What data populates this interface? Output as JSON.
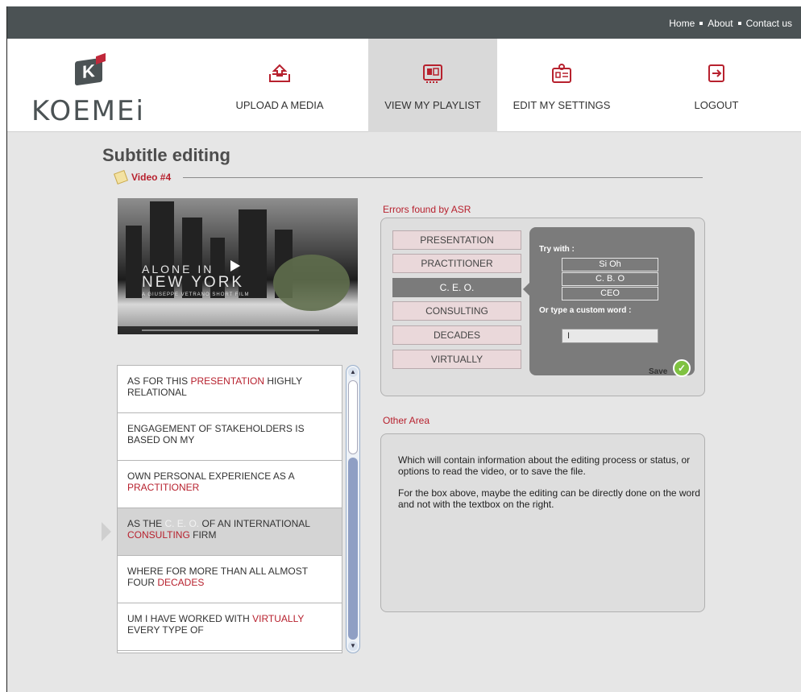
{
  "top_links": [
    "Home",
    "About",
    "Contact us"
  ],
  "logo": {
    "letter": "K",
    "word": "KOEMEi"
  },
  "nav": [
    {
      "label": "UPLOAD A MEDIA",
      "icon": "upload-icon"
    },
    {
      "label": "VIEW MY PLAYLIST",
      "icon": "playlist-icon"
    },
    {
      "label": "EDIT MY SETTINGS",
      "icon": "settings-icon"
    },
    {
      "label": "LOGOUT",
      "icon": "logout-icon"
    }
  ],
  "page": {
    "title": "Subtitle editing",
    "video_label": "Video #4"
  },
  "video": {
    "line1": "ALONE IN",
    "line2": "NEW YORK",
    "line3": "A GIUSEPPE VETRANO SHORT FILM"
  },
  "subtitles": [
    {
      "pre": "AS FOR THIS ",
      "err": "PRESENTATION",
      "post": " HIGHLY RELATIONAL"
    },
    {
      "pre": "ENGAGEMENT OF STAKEHOLDERS IS BASED ON MY",
      "err": "",
      "post": ""
    },
    {
      "pre": "OWN PERSONAL EXPERIENCE AS A ",
      "err": "PRACTITIONER",
      "post": ""
    },
    {
      "pre": "AS THE ",
      "err": "C. E. O.",
      "post": " OF AN INTERNATIONAL ",
      "err2": "CONSULTING",
      "post2": " FIRM",
      "active": true
    },
    {
      "pre": "WHERE FOR MORE THAN ALL ALMOST FOUR ",
      "err": "DECADES",
      "post": ""
    },
    {
      "pre": "UM I HAVE WORKED WITH ",
      "err": "VIRTUALLY",
      "post": " EVERY TYPE OF"
    }
  ],
  "errors_panel": {
    "title": "Errors found by ASR",
    "words": [
      "PRESENTATION",
      "PRACTITIONER",
      "C. E. O.",
      "CONSULTING",
      "DECADES",
      "VIRTUALLY"
    ],
    "active_index": 2,
    "try_with_label": "Try with :",
    "suggestions": [
      "Si Oh",
      "C. B. O",
      "CEO"
    ],
    "custom_label": "Or type a custom word :",
    "custom_value": "I",
    "save_label": "Save"
  },
  "other_area": {
    "title": "Other Area",
    "paragraph1": "Which will contain information about the editing process or status, or options to read the video, or to save the file.",
    "paragraph2": "For the box above, maybe the editing can be directly done on the word and not with the textbox on the right."
  },
  "colors": {
    "accent": "#b7212e",
    "topbar": "#4b5254",
    "active_word": "#7b7b7b",
    "save_green": "#7fc241"
  }
}
